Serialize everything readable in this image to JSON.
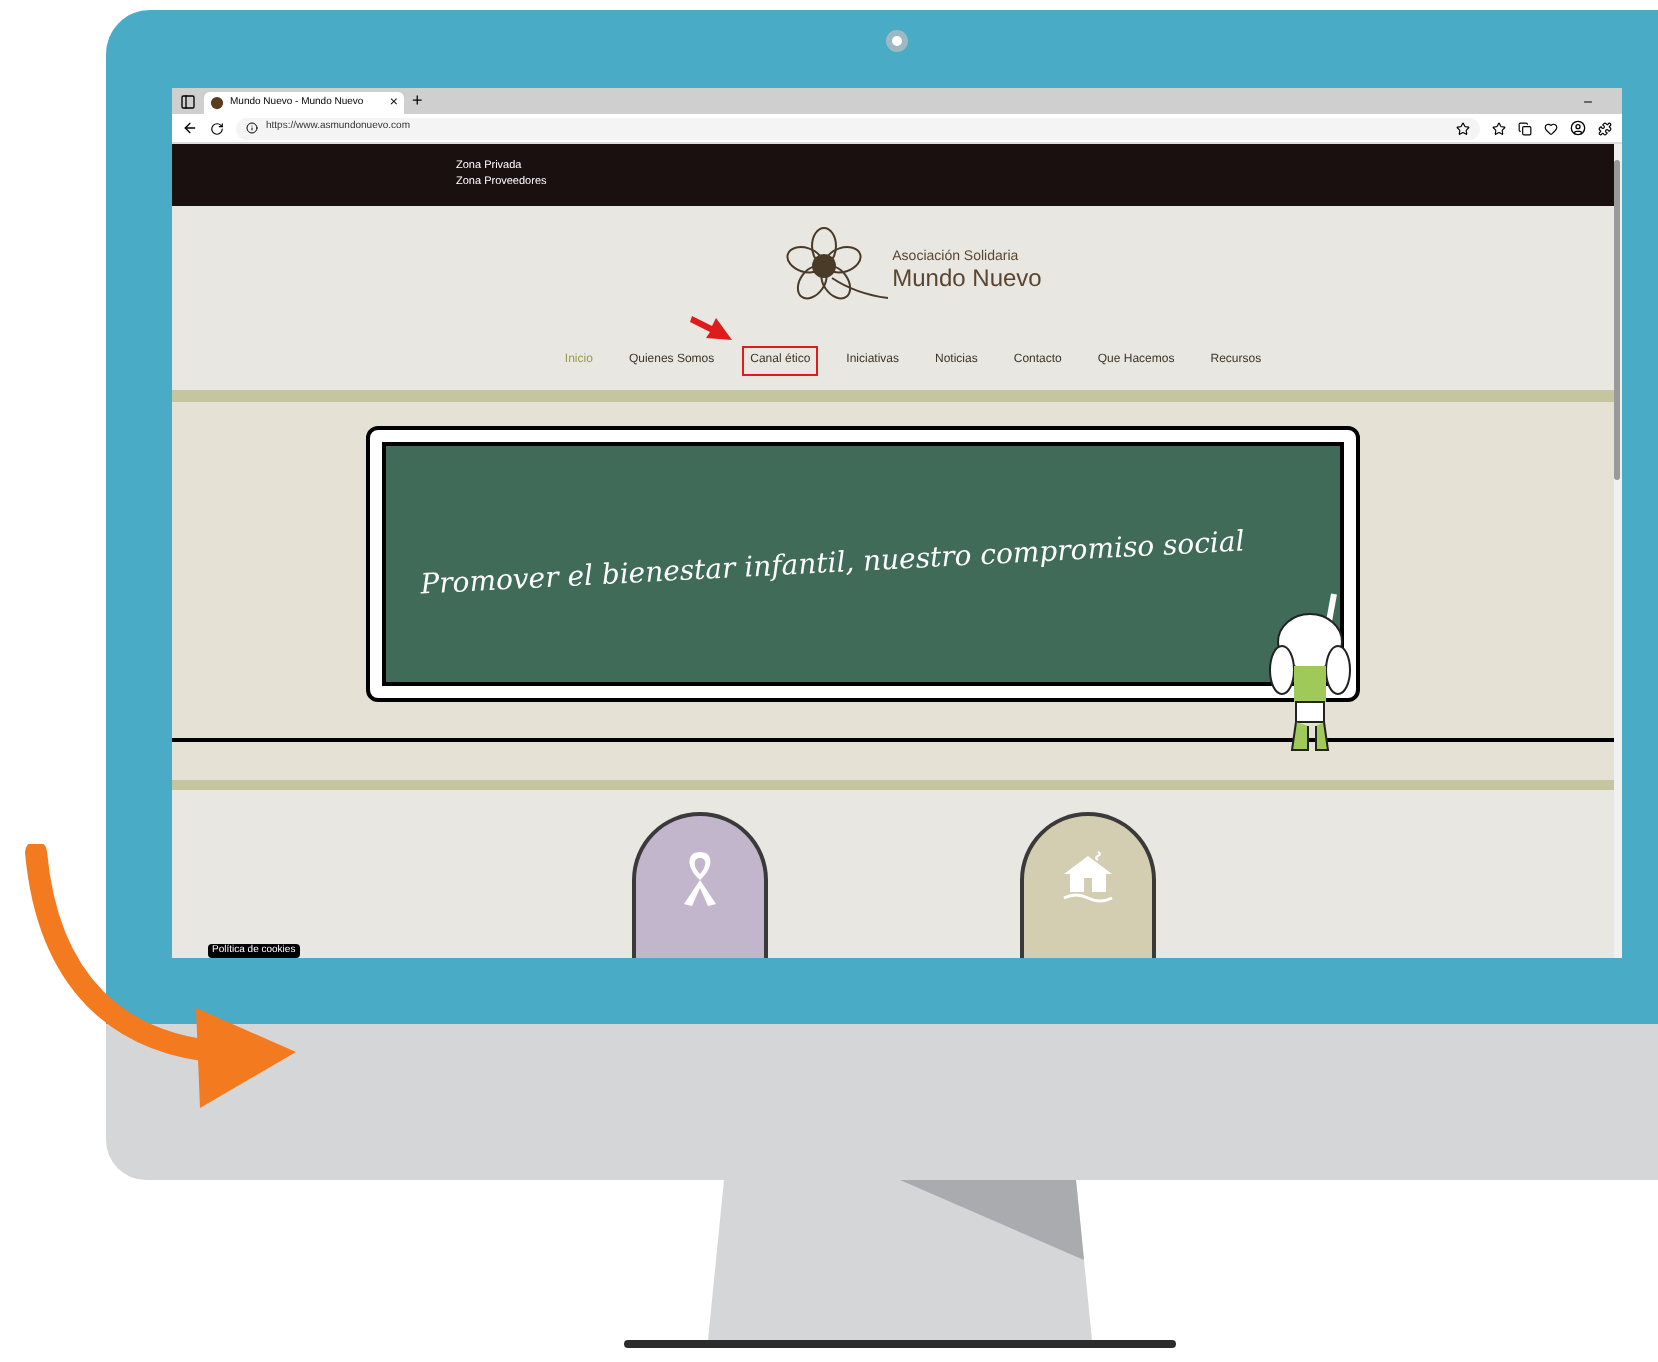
{
  "browser": {
    "tab_title": "Mundo Nuevo - Mundo Nuevo",
    "tab_close": "×",
    "new_tab": "+",
    "url": "https://www.asmundonuevo.com"
  },
  "top_links": [
    "Zona Privada",
    "Zona Proveedores"
  ],
  "logo": {
    "line1": "Asociación Solidaria",
    "line2": "Mundo Nuevo"
  },
  "nav": [
    {
      "label": "Inicio",
      "selected": true,
      "highlighted": false
    },
    {
      "label": "Quienes Somos",
      "selected": false,
      "highlighted": false
    },
    {
      "label": "Canal ético",
      "selected": false,
      "highlighted": true
    },
    {
      "label": "Iniciativas",
      "selected": false,
      "highlighted": false
    },
    {
      "label": "Noticias",
      "selected": false,
      "highlighted": false
    },
    {
      "label": "Contacto",
      "selected": false,
      "highlighted": false
    },
    {
      "label": "Que Hacemos",
      "selected": false,
      "highlighted": false
    },
    {
      "label": "Recursos",
      "selected": false,
      "highlighted": false
    }
  ],
  "banner": {
    "text": "Promover el bienestar infantil, nuestro compromiso social"
  },
  "features": [
    {
      "kind": "ribbon",
      "color": "#c2b6cc"
    },
    {
      "kind": "house",
      "color": "#d3ceb2"
    }
  ],
  "cookie_badge": "Política de cookies"
}
